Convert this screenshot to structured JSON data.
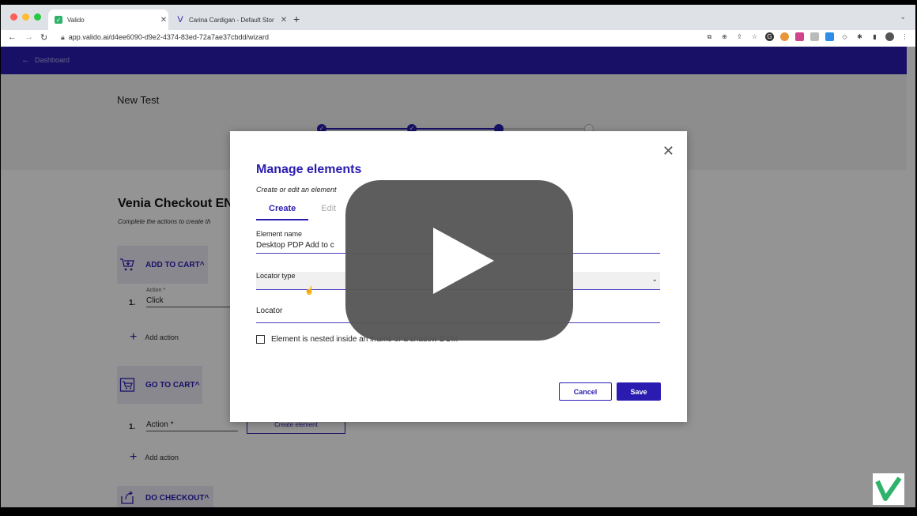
{
  "browser": {
    "tabs": [
      {
        "title": "Valido",
        "active": true
      },
      {
        "title": "Carina Cardigan - Default Stor",
        "active": false
      }
    ],
    "url": "app.valido.ai/d4ee6090-d9e2-4374-83ed-72a7ae37cbdd/wizard",
    "traffic_light_colors": [
      "#ff5f57",
      "#febc2e",
      "#28c840"
    ]
  },
  "appbar": {
    "back_label": "Dashboard",
    "color": "#2a1cb0"
  },
  "page": {
    "title": "New Test",
    "stepper": {
      "total_steps": 4,
      "completed": 2,
      "current": 3
    },
    "heading": "Venia Checkout EN",
    "subheading": "Complete the actions to create th",
    "sections": [
      {
        "label": "ADD TO CART",
        "icon": "cart-add-icon"
      },
      {
        "label": "GO TO CART",
        "icon": "cart-icon"
      },
      {
        "label": "DO CHECKOUT",
        "icon": "checkout-icon"
      }
    ],
    "actions": [
      {
        "number": "1.",
        "field_label": "Action *",
        "value": "Click"
      },
      {
        "number": "1.",
        "field_label": "",
        "value": "Action *"
      }
    ],
    "add_action_label": "Add action",
    "create_element_label": "Create element"
  },
  "modal": {
    "title": "Manage elements",
    "subtitle": "Create or edit an element",
    "tabs": [
      "Create",
      "Edit"
    ],
    "active_tab": "Create",
    "element_name_label": "Element name",
    "element_name_value": "Desktop PDP Add to c",
    "locator_type_label": "Locator type",
    "locator_label": "Locator",
    "checkbox_label": "Element is nested inside an iframe or a shadow DOM",
    "cancel_label": "Cancel",
    "save_label": "Save"
  }
}
